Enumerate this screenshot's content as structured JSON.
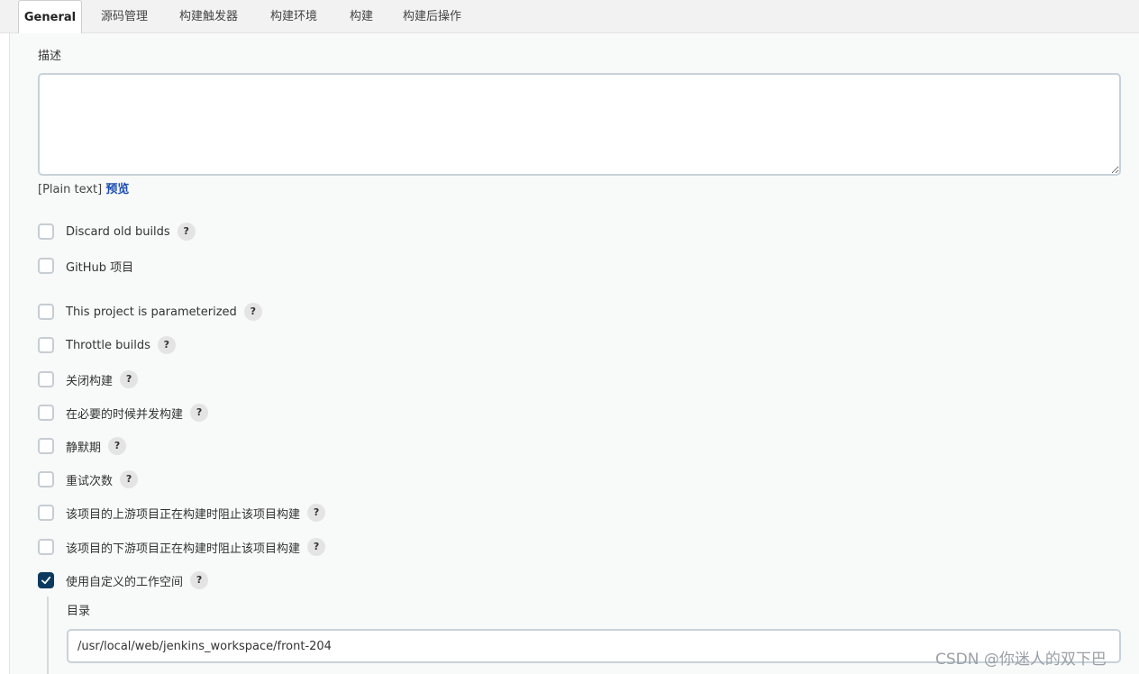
{
  "tabs": [
    {
      "label": "General",
      "active": true
    },
    {
      "label": "源码管理",
      "active": false
    },
    {
      "label": "构建触发器",
      "active": false
    },
    {
      "label": "构建环境",
      "active": false
    },
    {
      "label": "构建",
      "active": false
    },
    {
      "label": "构建后操作",
      "active": false
    }
  ],
  "description": {
    "label": "描述",
    "value": "",
    "format": "[Plain text]",
    "preview_link": "预览"
  },
  "options": [
    {
      "label": "Discard old builds",
      "checked": false,
      "help": "?"
    },
    {
      "label": "GitHub 项目",
      "checked": false,
      "help": ""
    },
    {
      "label": "This project is parameterized",
      "checked": false,
      "help": "?"
    },
    {
      "label": "Throttle builds",
      "checked": false,
      "help": "?"
    },
    {
      "label": "关闭构建",
      "checked": false,
      "help": "?"
    },
    {
      "label": "在必要的时候并发构建",
      "checked": false,
      "help": "?"
    },
    {
      "label": "静默期",
      "checked": false,
      "help": "?"
    },
    {
      "label": "重试次数",
      "checked": false,
      "help": "?"
    },
    {
      "label": "该项目的上游项目正在构建时阻止该项目构建",
      "checked": false,
      "help": "?"
    },
    {
      "label": "该项目的下游项目正在构建时阻止该项目构建",
      "checked": false,
      "help": "?"
    },
    {
      "label": "使用自定义的工作空间",
      "checked": true,
      "help": "?"
    }
  ],
  "workspace": {
    "label": "目录",
    "value": "/usr/local/web/jenkins_workspace/front-204"
  },
  "watermark": "CSDN @你迷人的双下巴",
  "colors": {
    "accent": "#0b3a5e",
    "link": "#1a4bb3",
    "panel_bg": "#f8f9f9",
    "tabbar_bg": "#f2f2f2"
  }
}
